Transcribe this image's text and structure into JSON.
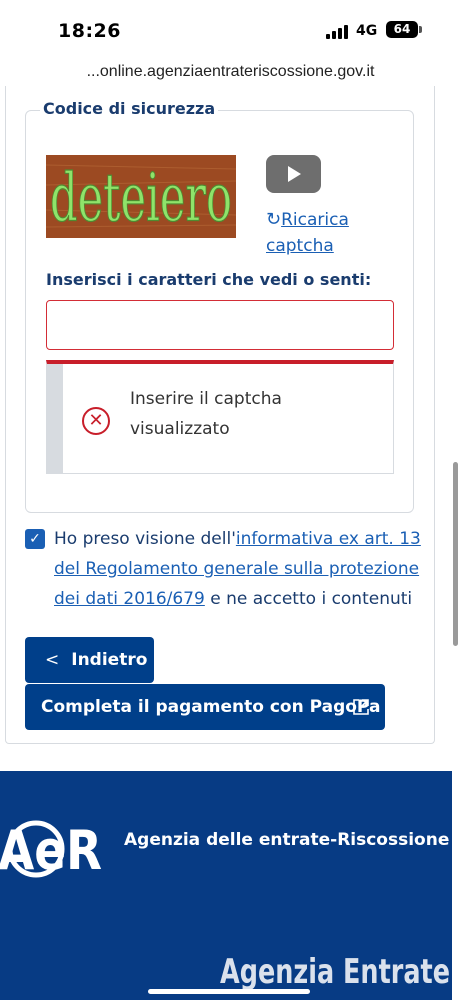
{
  "status_bar": {
    "time": "18:26",
    "network": "4G",
    "battery": "64"
  },
  "browser": {
    "url": "...online.agenziaentrateriscossione.gov.it"
  },
  "security": {
    "legend": "Codice di sicurezza",
    "captcha_text": "deteiero",
    "reload_label": "Ricarica captcha",
    "input_label": "Inserisci i caratteri che vedi o senti:",
    "input_value": "",
    "error_message": "Inserire il captcha visualizzato"
  },
  "consent": {
    "checked": true,
    "prefix": "Ho preso visione dell'",
    "link_text": "informativa ex art. 13 del Regolamento generale sulla protezione dei dati 2016/679",
    "suffix": " e ne accetto i contenuti"
  },
  "buttons": {
    "back_label": "Indietro",
    "pay_label": "Completa il pagamento con PagoPa"
  },
  "footer": {
    "title": "Agenzia delle entrate-Riscossione",
    "logo_text": "AeR",
    "logo2_text": "Agenzia Entrate"
  },
  "colors": {
    "brand": "#073b84",
    "primary": "#003f8a",
    "link": "#1a5fb4",
    "error": "#c81e2a"
  }
}
